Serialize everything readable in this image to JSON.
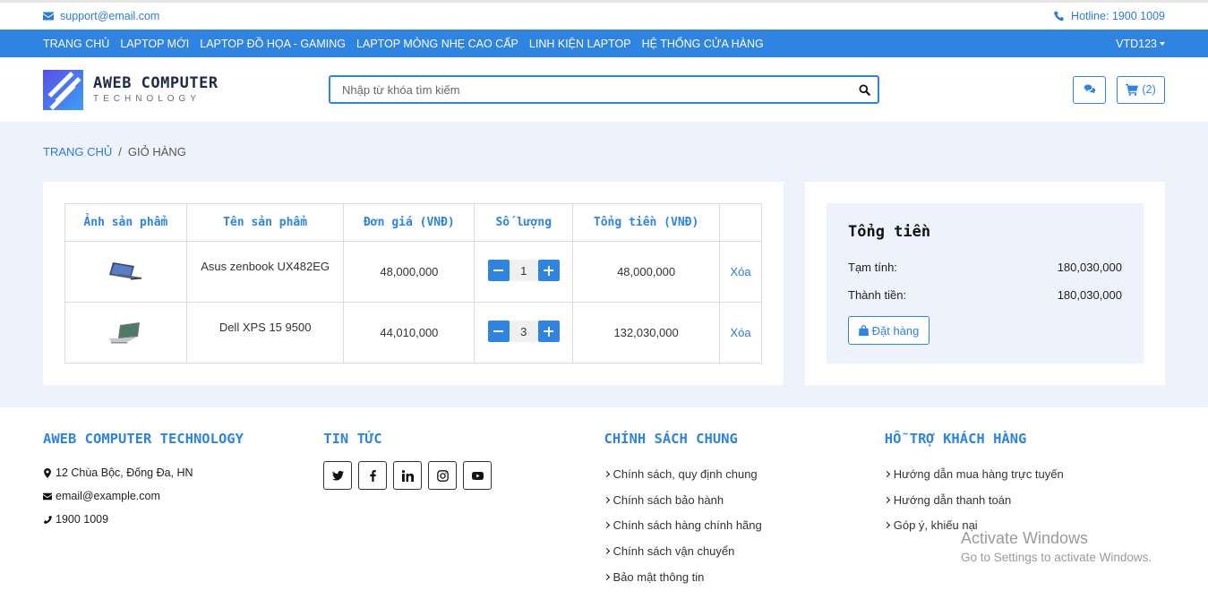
{
  "topbar": {
    "email": "support@email.com",
    "hotline": "Hotline: 1900 1009"
  },
  "nav": {
    "items": [
      "TRANG CHỦ",
      "LAPTOP MỚI",
      "LAPTOP ĐỒ HỌA - GAMING",
      "LAPTOP MỎNG NHẸ CAO CẤP",
      "LINH KIỆN LAPTOP",
      "HỆ THỐNG CỬA HÀNG"
    ],
    "user": "VTD123"
  },
  "header": {
    "logo_line1": "AWEB COMPUTER",
    "logo_line2": "TECHNOLOGY",
    "search_placeholder": "Nhập từ khóa tìm kiếm",
    "cart_count": "(2)"
  },
  "breadcrumb": {
    "home": "TRANG CHỦ",
    "sep": "/",
    "current": "GIỎ HÀNG"
  },
  "cart": {
    "columns": [
      "Ảnh sản phẩm",
      "Tên sản phẩm",
      "Đơn giá (VNĐ)",
      "Số lượng",
      "Tổng tiền (VNĐ)",
      ""
    ],
    "rows": [
      {
        "name": "Asus zenbook UX482EG",
        "price": "48,000,000",
        "qty": "1",
        "total": "48,000,000",
        "action": "Xóa"
      },
      {
        "name": "Dell XPS 15 9500",
        "price": "44,010,000",
        "qty": "3",
        "total": "132,030,000",
        "action": "Xóa"
      }
    ]
  },
  "summary": {
    "title": "Tổng tiền",
    "subtotal_label": "Tạm tính:",
    "subtotal": "180,030,000",
    "total_label": "Thành tiền:",
    "total": "180,030,000",
    "order_button": "Đặt hàng"
  },
  "footer": {
    "col1": {
      "title": "AWEB COMPUTER TECHNOLOGY",
      "address": "12 Chùa Bộc, Đống Đa, HN",
      "email": "email@example.com",
      "phone": "1900 1009"
    },
    "col2": {
      "title": "TIN TỨC",
      "socials": [
        "twitter-icon",
        "facebook-icon",
        "linkedin-icon",
        "instagram-icon",
        "youtube-icon"
      ]
    },
    "col3": {
      "title": "CHÍNH SÁCH CHUNG",
      "links": [
        "Chính sách, quy định chung",
        "Chính sách bảo hành",
        "Chính sách hàng chính hãng",
        "Chính sách vận chuyển",
        "Bảo mật thông tin"
      ]
    },
    "col4": {
      "title": "HỖ TRỢ KHÁCH HÀNG",
      "links": [
        "Hướng dẫn mua hàng trực tuyến",
        "Hướng dẫn thanh toán",
        "Góp ý, khiếu nại"
      ]
    }
  },
  "watermark": {
    "line1": "Activate Windows",
    "line2": "Go to Settings to activate Windows."
  },
  "colors": {
    "accent": "#2e84e0",
    "page_bg": "#eef2fc"
  }
}
